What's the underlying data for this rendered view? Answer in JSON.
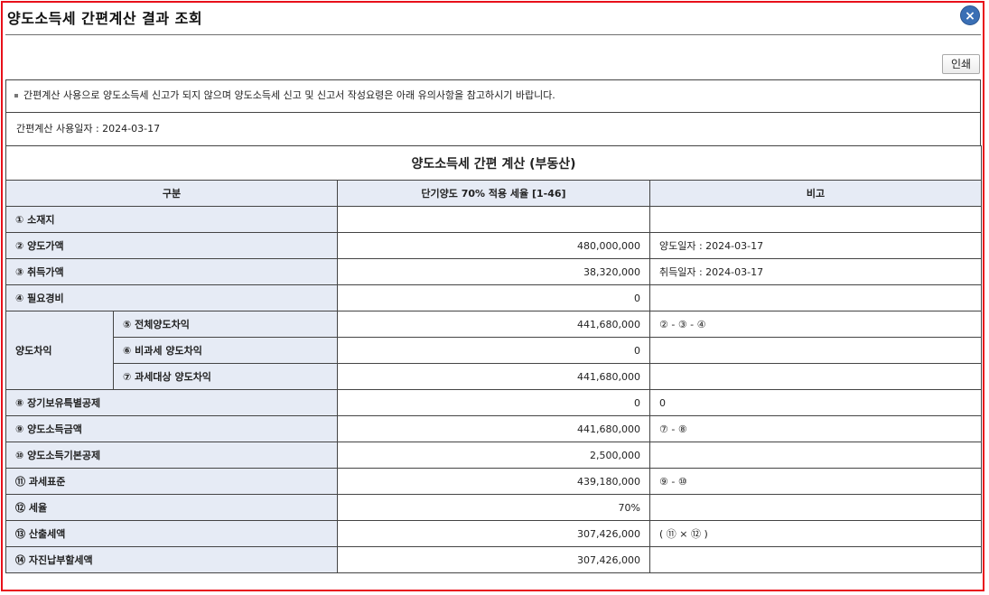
{
  "dialog": {
    "title": "양도소득세 간편계산 결과 조회",
    "close_label": "×",
    "print_label": "인쇄"
  },
  "notice": "간편계산 사용으로 양도소득세 신고가 되지 않으며 양도소득세 신고 및 신고서 작성요령은 아래 유의사항을 참고하시기 바랍니다.",
  "usage_date": "간편계산 사용일자 : 2024-03-17",
  "table": {
    "caption": "양도소득세 간편 계산 (부동산)",
    "headers": [
      "구분",
      "단기양도 70% 적용 세율 [1-46]",
      "비고"
    ],
    "group_label": "양도차익",
    "rows": [
      {
        "label": "① 소재지",
        "value": "",
        "memo": ""
      },
      {
        "label": "② 양도가액",
        "value": "480,000,000",
        "memo": "양도일자 : 2024-03-17"
      },
      {
        "label": "③ 취득가액",
        "value": "38,320,000",
        "memo": "취득일자 : 2024-03-17"
      },
      {
        "label": "④ 필요경비",
        "value": "0",
        "memo": ""
      },
      {
        "label": "⑤ 전체양도차익",
        "value": "441,680,000",
        "memo": "② - ③ - ④"
      },
      {
        "label": "⑥ 비과세 양도차익",
        "value": "0",
        "memo": ""
      },
      {
        "label": "⑦ 과세대상 양도차익",
        "value": "441,680,000",
        "memo": ""
      },
      {
        "label": "⑧ 장기보유특별공제",
        "value": "0",
        "memo": "0"
      },
      {
        "label": "⑨ 양도소득금액",
        "value": "441,680,000",
        "memo": "⑦ - ⑧"
      },
      {
        "label": "⑩ 양도소득기본공제",
        "value": "2,500,000",
        "memo": ""
      },
      {
        "label": "⑪ 과세표준",
        "value": "439,180,000",
        "memo": "⑨ - ⑩"
      },
      {
        "label": "⑫ 세율",
        "value": "70%",
        "memo": ""
      },
      {
        "label": "⑬ 산출세액",
        "value": "307,426,000",
        "memo": "( ⑪ × ⑫ )"
      },
      {
        "label": "⑭ 자진납부할세액",
        "value": "307,426,000",
        "memo": ""
      }
    ]
  }
}
